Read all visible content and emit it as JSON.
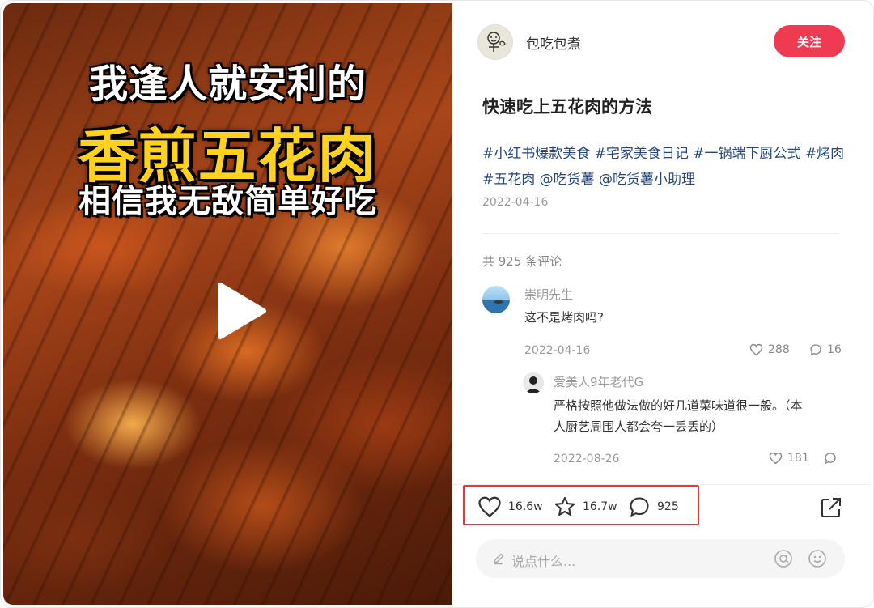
{
  "media": {
    "overlay_line1": "我逢人就安利的",
    "overlay_line2": "香煎五花肉",
    "overlay_line3": "相信我无敌简单好吃",
    "play_icon": "play-icon"
  },
  "author": {
    "name": "包吃包煮",
    "follow_label": "关注"
  },
  "post": {
    "title": "快速吃上五花肉的方法",
    "tags_line": "#小红书爆款美食 #宅家美食日记 #一锅端下厨公式 #烤肉 #五花肉 @吃货薯 @吃货薯小助理",
    "date": "2022-04-16"
  },
  "comments": {
    "count_label": "共 925 条评论",
    "items": [
      {
        "name": "崇明先生",
        "text": "这不是烤肉吗?",
        "date": "2022-04-16",
        "likes": "288",
        "replies": "16"
      },
      {
        "name": "爱美人9年老代G",
        "text_line1": "严格按照他做法做的好几道菜味道很一般。（本",
        "text_line2": "人厨艺周围人都会夸一丢丢的）",
        "date": "2022-08-26",
        "likes": "181"
      }
    ]
  },
  "actions": {
    "likes": "16.6w",
    "favorites": "16.7w",
    "comments": "925"
  },
  "input": {
    "placeholder": "说点什么..."
  },
  "colors": {
    "accent": "#ef3b52",
    "tag_blue": "#26467a",
    "highlight_box": "#e53935"
  }
}
